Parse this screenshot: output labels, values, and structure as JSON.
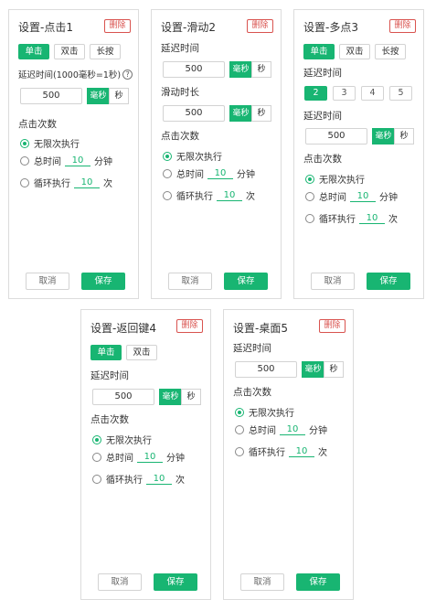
{
  "colors": {
    "accent": "#18b572",
    "danger": "#d9534f",
    "border": "#dcdcdc"
  },
  "common": {
    "delete_label": "删除",
    "cancel_label": "取消",
    "save_label": "保存",
    "ms_label": "毫秒",
    "sec_label": "秒",
    "click_count_label": "点击次数",
    "delay_label": "延迟时间",
    "unlimited_label": "无限次执行",
    "total_time_label": "总时间",
    "minutes_label": "分钟",
    "loop_label": "循环执行",
    "times_label": "次"
  },
  "cards": [
    {
      "title": "设置-点击1",
      "tabs": [
        "单击",
        "双击",
        "长按"
      ],
      "active_tab": 0,
      "delay_label": "延迟时间(1000毫秒=1秒)",
      "help_icon": "question-circle-icon",
      "delay_value": "500",
      "total_time_value": "10",
      "loop_value": "10",
      "selected_option": "unlimited"
    },
    {
      "title": "设置-滑动2",
      "delay_value": "500",
      "slide_duration_label": "滑动时长",
      "slide_duration_value": "500",
      "total_time_value": "10",
      "loop_value": "10",
      "selected_option": "unlimited"
    },
    {
      "title": "设置-多点3",
      "tabs": [
        "单击",
        "双击",
        "长按"
      ],
      "active_tab": 0,
      "points": [
        "2",
        "3",
        "4",
        "5"
      ],
      "active_point": 0,
      "delay_value": "500",
      "total_time_value": "10",
      "loop_value": "10",
      "selected_option": "unlimited"
    },
    {
      "title": "设置-返回键4",
      "tabs": [
        "单击",
        "双击"
      ],
      "active_tab": 0,
      "delay_value": "500",
      "total_time_value": "10",
      "loop_value": "10",
      "selected_option": "unlimited"
    },
    {
      "title": "设置-桌面5",
      "delay_value": "500",
      "total_time_value": "10",
      "loop_value": "10",
      "selected_option": "unlimited"
    }
  ]
}
